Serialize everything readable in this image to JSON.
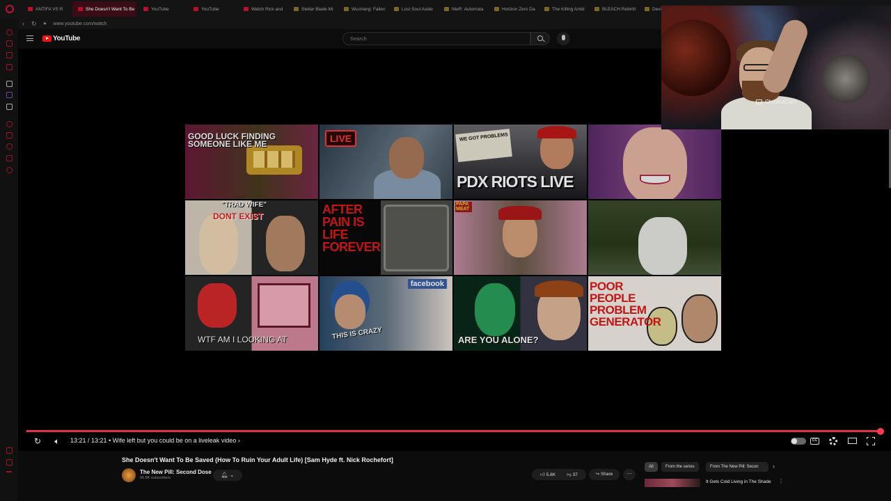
{
  "browser": {
    "url": "www.youtube.com/watch",
    "tabs": [
      {
        "label": "ANTIFA VS R",
        "active": false
      },
      {
        "label": "She Doesn't Want To Be",
        "active": true
      },
      {
        "label": "YouTube",
        "active": false
      },
      {
        "label": "YouTube",
        "active": false
      },
      {
        "label": "Watch Rick and",
        "active": false
      },
      {
        "label": "Stellar Blade Mi",
        "active": false
      },
      {
        "label": "Wuchang: Fallen",
        "active": false
      },
      {
        "label": "Lost Soul Aside",
        "active": false
      },
      {
        "label": "NieR: Automata",
        "active": false
      },
      {
        "label": "Horizon Zero Da",
        "active": false
      },
      {
        "label": "The Killing Antid",
        "active": false
      },
      {
        "label": "BLEACH Rebirth",
        "active": false
      },
      {
        "label": "Devil M",
        "active": false
      }
    ]
  },
  "youtube": {
    "logo_text": "YouTube",
    "search_placeholder": "Search"
  },
  "webcam": {
    "label": "ChromaCam"
  },
  "thumbnails": [
    {
      "text": "GOOD LUCK FINDING SOMEONE LIKE ME"
    },
    {
      "text": "LIVE"
    },
    {
      "text": "PDX RIOTS LIVE",
      "sign": "WE GOT PROBLEMS"
    },
    {
      "text": ""
    },
    {
      "text": "DONT EXIST",
      "label": "\"TRAD WIFE\""
    },
    {
      "text": "AFTER PAIN IS LIFE FOREVER"
    },
    {
      "text": "PAPA MEAT"
    },
    {
      "text": ""
    },
    {
      "text": "WTF AM I LOOKING AT"
    },
    {
      "text": "THIS IS CRAZY",
      "badge": "facebook"
    },
    {
      "text": "ARE YOU ALONE?"
    },
    {
      "text": "POOR PEOPLE PROBLEM GENERATOR"
    }
  ],
  "player": {
    "time": "13:21 / 13:21",
    "chapter": "• Wife left but you could be on a liveleak video",
    "chapter_arrow": "›",
    "progress": 1.0
  },
  "video": {
    "title": "She Doesn't Want To Be Saved (How To Ruin Your Adult Life) [Sam Hyde ft. Nick Rochefort]",
    "channel": "The New Pill: Second Dose",
    "subscribers": "66.8K subscribers",
    "likes": "5.8K",
    "dislikes": "37",
    "share_label": "Share",
    "more_label": "···"
  },
  "recommendations": {
    "chips": [
      "All",
      "From the series",
      "From The New Pill: Secon"
    ],
    "first_title": "It Gets Cold Living in The Shade"
  }
}
